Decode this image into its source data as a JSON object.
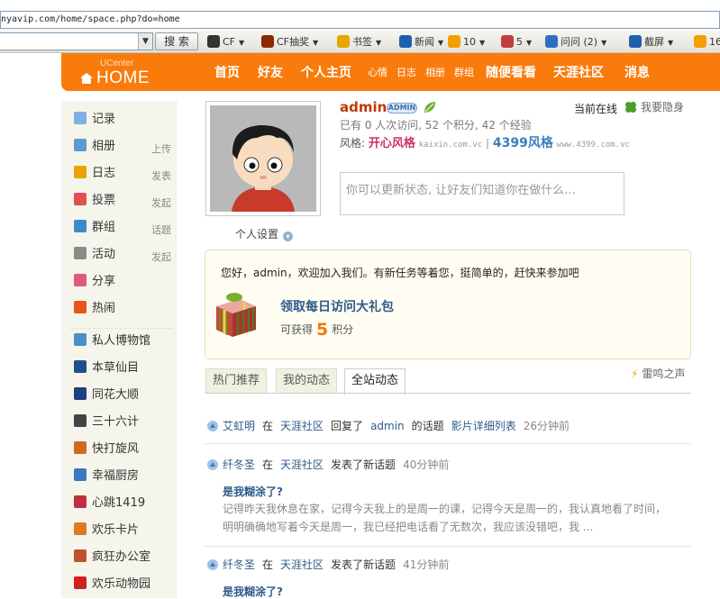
{
  "browser": {
    "url": "nyavip.com/home/space.php?do=home",
    "search_button": "搜 索",
    "toolbar": [
      {
        "label": "CF",
        "icon": "cf-icon",
        "color": "#333333"
      },
      {
        "label": "CF抽奖",
        "icon": "cf-lottery-icon",
        "color": "#8b2a00"
      },
      {
        "label": "书签",
        "icon": "bookmark-icon",
        "color": "#e6a500"
      },
      {
        "label": "新闻",
        "icon": "news-icon",
        "color": "#1f5fb0"
      },
      {
        "label": "10",
        "icon": "points-icon",
        "color": "#f2a000"
      },
      {
        "label": "5",
        "icon": "mail-icon",
        "color": "#c04040"
      },
      {
        "label": "问问 (2)",
        "icon": "question-icon",
        "color": "#2f6fc0"
      },
      {
        "label": "截屏",
        "icon": "screenshot-icon",
        "color": "#1f5fb0"
      },
      {
        "label": "16",
        "icon": "sun-icon",
        "color": "#f2a000"
      }
    ]
  },
  "site": {
    "logo_small": "UCenter",
    "logo": "HOME",
    "nav": [
      {
        "label": "首页",
        "size": "lg"
      },
      {
        "label": "好友",
        "size": "lg"
      },
      {
        "label": "个人主页",
        "size": "lg"
      },
      {
        "label": "心情",
        "size": "sm"
      },
      {
        "label": "日志",
        "size": "sm"
      },
      {
        "label": "相册",
        "size": "sm"
      },
      {
        "label": "群组",
        "size": "sm"
      },
      {
        "label": "随便看看",
        "size": "lg"
      },
      {
        "label": "天涯社区",
        "size": "lg"
      },
      {
        "label": "消息",
        "size": "lg"
      }
    ]
  },
  "sidebar": {
    "items": [
      {
        "label": "记录",
        "sub": "",
        "icon": "record-icon",
        "color": "#7fb0e0"
      },
      {
        "label": "相册",
        "sub": "上传",
        "icon": "album-icon",
        "color": "#5b9bd5"
      },
      {
        "label": "日志",
        "sub": "发表",
        "icon": "blog-icon",
        "color": "#e6a500"
      },
      {
        "label": "投票",
        "sub": "发起",
        "icon": "poll-icon",
        "color": "#e05050"
      },
      {
        "label": "群组",
        "sub": "话题",
        "icon": "group-icon",
        "color": "#3a8ad0"
      },
      {
        "label": "活动",
        "sub": "发起",
        "icon": "event-icon",
        "color": "#8a8a8a"
      },
      {
        "label": "分享",
        "sub": "",
        "icon": "share-icon",
        "color": "#e05a7a"
      },
      {
        "label": "热闹",
        "sub": "",
        "icon": "hot-icon",
        "color": "#e8551a"
      }
    ],
    "apps": [
      {
        "label": "私人博物馆",
        "icon": "museum-icon",
        "color": "#4a90c8"
      },
      {
        "label": "本草仙目",
        "icon": "herb-icon",
        "color": "#1f4f8f"
      },
      {
        "label": "同花大顺",
        "icon": "poker-icon",
        "color": "#1f3f7f"
      },
      {
        "label": "三十六计",
        "icon": "strategy-icon",
        "color": "#444444"
      },
      {
        "label": "快打旋风",
        "icon": "fighter-icon",
        "color": "#d06a20"
      },
      {
        "label": "幸福厨房",
        "icon": "kitchen-icon",
        "color": "#3a78c0"
      },
      {
        "label": "心跳1419",
        "icon": "heartbeat-icon",
        "color": "#c03040"
      },
      {
        "label": "欢乐卡片",
        "icon": "cards-icon",
        "color": "#e07a20"
      },
      {
        "label": "疯狂办公室",
        "icon": "office-icon",
        "color": "#c05030"
      },
      {
        "label": "欢乐动物园",
        "icon": "zoo-icon",
        "color": "#d02020"
      }
    ]
  },
  "profile": {
    "username": "admin",
    "badge": "ADMIN",
    "online_label": "当前在线",
    "invisible_label": "我要隐身",
    "stats": "已有 0 人次访问, 52 个积分, 42 个经验",
    "style_prefix": "风格:",
    "style1": "开心风格",
    "style1_url": "kaixin.com.vc",
    "style2": "4399风格",
    "style2_url": "www.4399.com.vc",
    "status_placeholder": "你可以更新状态, 让好友们知道你在做什么...",
    "settings_label": "个人设置"
  },
  "task": {
    "welcome": "您好，admin，欢迎加入我们。有新任务等着您，挺简单的，赶快来参加吧",
    "title": "领取每日访问大礼包",
    "reward_prefix": "可获得",
    "reward_points": "5",
    "reward_suffix": "积分"
  },
  "tabs": [
    {
      "label": "热门推荐",
      "active": false
    },
    {
      "label": "我的动态",
      "active": false
    },
    {
      "label": "全站动态",
      "active": true
    }
  ],
  "thunder_label": "雷鸣之声",
  "feed": [
    {
      "user": "艾虹明",
      "mid": "在",
      "place": "天涯社区",
      "action": "回复了",
      "target_user": "admin",
      "action2": "的话题",
      "target": "影片详细列表",
      "time": "26分钟前",
      "title": "",
      "body1": "",
      "body2": ""
    },
    {
      "user": "纤冬圣",
      "mid": "在",
      "place": "天涯社区",
      "action": "发表了新话题",
      "target_user": "",
      "action2": "",
      "target": "",
      "time": "40分钟前",
      "title": "是我糊涂了?",
      "body1": "记得昨天我休息在家，记得今天我上的是周一的课，记得今天是周一的，我认真地看了时间，",
      "body2": "明明确确地写着今天是周一，我已经把电话看了无数次，我应该没错吧，我 ..."
    },
    {
      "user": "纤冬圣",
      "mid": "在",
      "place": "天涯社区",
      "action": "发表了新话题",
      "target_user": "",
      "action2": "",
      "target": "",
      "time": "41分钟前",
      "title": "是我糊涂了?",
      "body1": "",
      "body2": ""
    }
  ]
}
